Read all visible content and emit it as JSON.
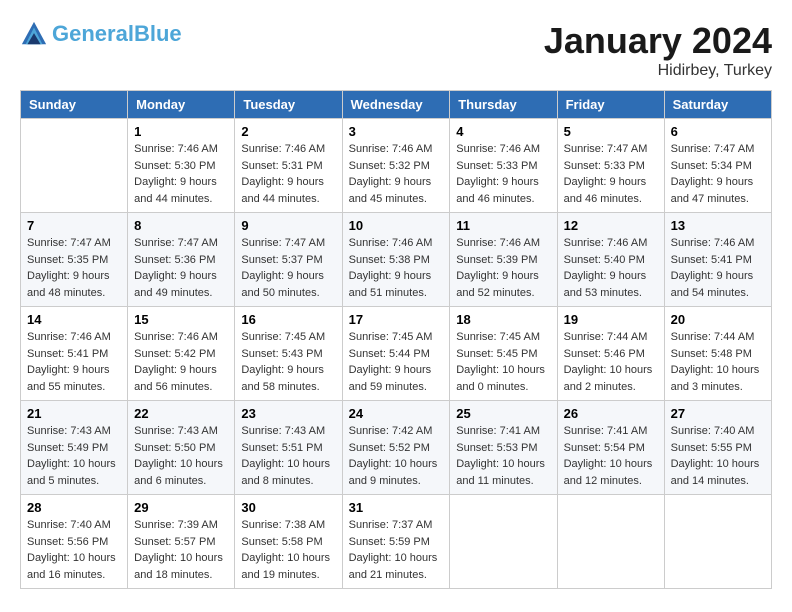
{
  "header": {
    "logo_line1": "General",
    "logo_line2": "Blue",
    "month": "January 2024",
    "location": "Hidirbey, Turkey"
  },
  "days_of_week": [
    "Sunday",
    "Monday",
    "Tuesday",
    "Wednesday",
    "Thursday",
    "Friday",
    "Saturday"
  ],
  "weeks": [
    [
      {
        "day": "",
        "info": ""
      },
      {
        "day": "1",
        "info": "Sunrise: 7:46 AM\nSunset: 5:30 PM\nDaylight: 9 hours\nand 44 minutes."
      },
      {
        "day": "2",
        "info": "Sunrise: 7:46 AM\nSunset: 5:31 PM\nDaylight: 9 hours\nand 44 minutes."
      },
      {
        "day": "3",
        "info": "Sunrise: 7:46 AM\nSunset: 5:32 PM\nDaylight: 9 hours\nand 45 minutes."
      },
      {
        "day": "4",
        "info": "Sunrise: 7:46 AM\nSunset: 5:33 PM\nDaylight: 9 hours\nand 46 minutes."
      },
      {
        "day": "5",
        "info": "Sunrise: 7:47 AM\nSunset: 5:33 PM\nDaylight: 9 hours\nand 46 minutes."
      },
      {
        "day": "6",
        "info": "Sunrise: 7:47 AM\nSunset: 5:34 PM\nDaylight: 9 hours\nand 47 minutes."
      }
    ],
    [
      {
        "day": "7",
        "info": "Sunrise: 7:47 AM\nSunset: 5:35 PM\nDaylight: 9 hours\nand 48 minutes."
      },
      {
        "day": "8",
        "info": "Sunrise: 7:47 AM\nSunset: 5:36 PM\nDaylight: 9 hours\nand 49 minutes."
      },
      {
        "day": "9",
        "info": "Sunrise: 7:47 AM\nSunset: 5:37 PM\nDaylight: 9 hours\nand 50 minutes."
      },
      {
        "day": "10",
        "info": "Sunrise: 7:46 AM\nSunset: 5:38 PM\nDaylight: 9 hours\nand 51 minutes."
      },
      {
        "day": "11",
        "info": "Sunrise: 7:46 AM\nSunset: 5:39 PM\nDaylight: 9 hours\nand 52 minutes."
      },
      {
        "day": "12",
        "info": "Sunrise: 7:46 AM\nSunset: 5:40 PM\nDaylight: 9 hours\nand 53 minutes."
      },
      {
        "day": "13",
        "info": "Sunrise: 7:46 AM\nSunset: 5:41 PM\nDaylight: 9 hours\nand 54 minutes."
      }
    ],
    [
      {
        "day": "14",
        "info": "Sunrise: 7:46 AM\nSunset: 5:41 PM\nDaylight: 9 hours\nand 55 minutes."
      },
      {
        "day": "15",
        "info": "Sunrise: 7:46 AM\nSunset: 5:42 PM\nDaylight: 9 hours\nand 56 minutes."
      },
      {
        "day": "16",
        "info": "Sunrise: 7:45 AM\nSunset: 5:43 PM\nDaylight: 9 hours\nand 58 minutes."
      },
      {
        "day": "17",
        "info": "Sunrise: 7:45 AM\nSunset: 5:44 PM\nDaylight: 9 hours\nand 59 minutes."
      },
      {
        "day": "18",
        "info": "Sunrise: 7:45 AM\nSunset: 5:45 PM\nDaylight: 10 hours\nand 0 minutes."
      },
      {
        "day": "19",
        "info": "Sunrise: 7:44 AM\nSunset: 5:46 PM\nDaylight: 10 hours\nand 2 minutes."
      },
      {
        "day": "20",
        "info": "Sunrise: 7:44 AM\nSunset: 5:48 PM\nDaylight: 10 hours\nand 3 minutes."
      }
    ],
    [
      {
        "day": "21",
        "info": "Sunrise: 7:43 AM\nSunset: 5:49 PM\nDaylight: 10 hours\nand 5 minutes."
      },
      {
        "day": "22",
        "info": "Sunrise: 7:43 AM\nSunset: 5:50 PM\nDaylight: 10 hours\nand 6 minutes."
      },
      {
        "day": "23",
        "info": "Sunrise: 7:43 AM\nSunset: 5:51 PM\nDaylight: 10 hours\nand 8 minutes."
      },
      {
        "day": "24",
        "info": "Sunrise: 7:42 AM\nSunset: 5:52 PM\nDaylight: 10 hours\nand 9 minutes."
      },
      {
        "day": "25",
        "info": "Sunrise: 7:41 AM\nSunset: 5:53 PM\nDaylight: 10 hours\nand 11 minutes."
      },
      {
        "day": "26",
        "info": "Sunrise: 7:41 AM\nSunset: 5:54 PM\nDaylight: 10 hours\nand 12 minutes."
      },
      {
        "day": "27",
        "info": "Sunrise: 7:40 AM\nSunset: 5:55 PM\nDaylight: 10 hours\nand 14 minutes."
      }
    ],
    [
      {
        "day": "28",
        "info": "Sunrise: 7:40 AM\nSunset: 5:56 PM\nDaylight: 10 hours\nand 16 minutes."
      },
      {
        "day": "29",
        "info": "Sunrise: 7:39 AM\nSunset: 5:57 PM\nDaylight: 10 hours\nand 18 minutes."
      },
      {
        "day": "30",
        "info": "Sunrise: 7:38 AM\nSunset: 5:58 PM\nDaylight: 10 hours\nand 19 minutes."
      },
      {
        "day": "31",
        "info": "Sunrise: 7:37 AM\nSunset: 5:59 PM\nDaylight: 10 hours\nand 21 minutes."
      },
      {
        "day": "",
        "info": ""
      },
      {
        "day": "",
        "info": ""
      },
      {
        "day": "",
        "info": ""
      }
    ]
  ]
}
